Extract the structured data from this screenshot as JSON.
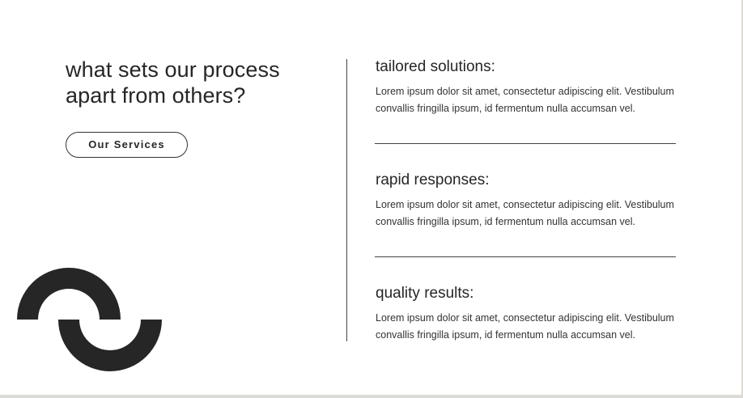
{
  "hero": {
    "headline": "what sets our process apart from others?",
    "button_label": "Our Services"
  },
  "features": [
    {
      "title": "tailored solutions:",
      "description": "Lorem ipsum dolor sit amet, consectetur adipiscing elit. Vestibulum convallis fringilla ipsum, id fermentum nulla accumsan vel."
    },
    {
      "title": "rapid responses:",
      "description": "Lorem ipsum dolor sit amet, consectetur adipiscing elit. Vestibulum convallis fringilla ipsum, id fermentum nulla accumsan vel."
    },
    {
      "title": "quality results:",
      "description": "Lorem ipsum dolor sit amet, consectetur adipiscing elit. Vestibulum convallis fringilla ipsum, id fermentum nulla accumsan vel."
    }
  ],
  "colors": {
    "text": "#262626",
    "logo": "#262626",
    "divider": "#444444",
    "background": "#ffffff"
  },
  "icons": {
    "logo": "interlocking-arcs-logo-icon"
  }
}
